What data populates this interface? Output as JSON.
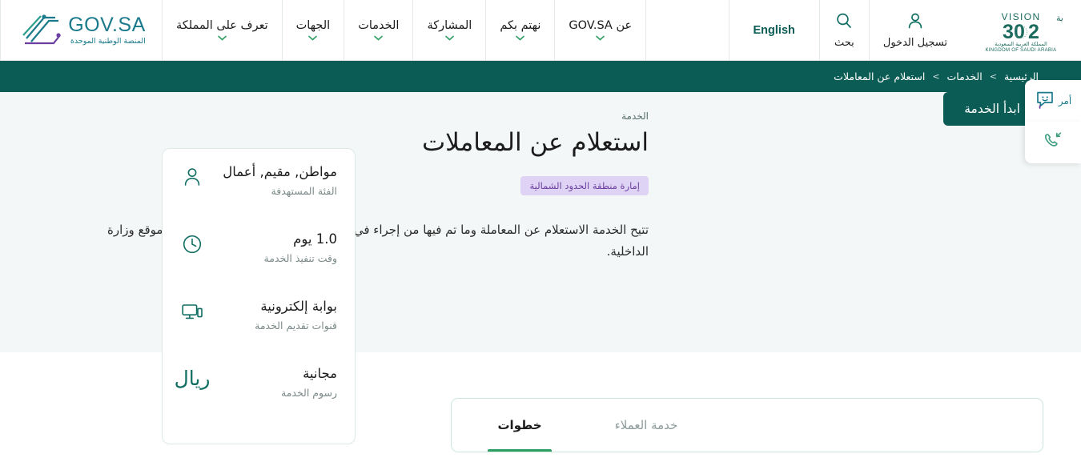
{
  "header": {
    "logo": {
      "govsa_main": "GOV.SA",
      "govsa_sub": "المنصة الوطنية الموحدة",
      "vision_title": "VISION",
      "vision_arabic": "رؤية",
      "vision_year": "2030",
      "vision_sub_ar": "المملكة العربية السعودية",
      "vision_sub_en": "KINGDOM OF SAUDI ARABIA"
    },
    "nav": [
      {
        "label": "تعرف على المملكة",
        "has_chevron": true
      },
      {
        "label": "الجهات",
        "has_chevron": true
      },
      {
        "label": "الخدمات",
        "has_chevron": true
      },
      {
        "label": "المشاركة",
        "has_chevron": true
      },
      {
        "label": "نهتم بكم",
        "has_chevron": true
      },
      {
        "label": "عن GOV.SA",
        "has_chevron": true
      }
    ],
    "language": "English",
    "search_label": "بحث",
    "login_label": "تسجيل الدخول"
  },
  "breadcrumb": {
    "items": [
      "الرئيسية",
      "الخدمات",
      "استعلام عن المعاملات"
    ],
    "separator": ">"
  },
  "hero": {
    "eyebrow": "الخدمة",
    "title": "استعلام عن المعاملات",
    "badge": "إمارة منطقة الحدود الشمالية",
    "description": "تتيح الخدمة الاستعلام عن المعاملة وما تم فيها من إجراء في الإمارة عن طريق تسجيل الدخول في موقع وزارة الداخلية.",
    "start_button": "ابدأ الخدمة"
  },
  "info_card": {
    "rows": [
      {
        "icon": "user-icon",
        "value": "مواطن, مقيم, أعمال",
        "label": "الفئة المستهدفة"
      },
      {
        "icon": "clock-icon",
        "value": "1.0 يوم",
        "label": "وقت تنفيذ الخدمة"
      },
      {
        "icon": "device-icon",
        "value": "بوابة إلكترونية",
        "label": "قنوات تقديم الخدمة"
      },
      {
        "icon": "riyal-icon",
        "value": "مجانية",
        "label": "رسوم الخدمة"
      }
    ]
  },
  "tabs": [
    {
      "label": "خطوات",
      "active": true
    },
    {
      "label": "خدمة العملاء",
      "active": false
    }
  ],
  "floating": {
    "chat_label": "أمر",
    "callback_label": ""
  },
  "colors": {
    "brand_teal": "#0A5C55",
    "logo_blue": "#1B7A8C",
    "badge_bg": "#DFD3F5",
    "badge_text": "#6B3FA0",
    "tab_underline": "#2E9E63",
    "hero_bg": "#F4F7F7",
    "icon_green": "#116E63"
  }
}
